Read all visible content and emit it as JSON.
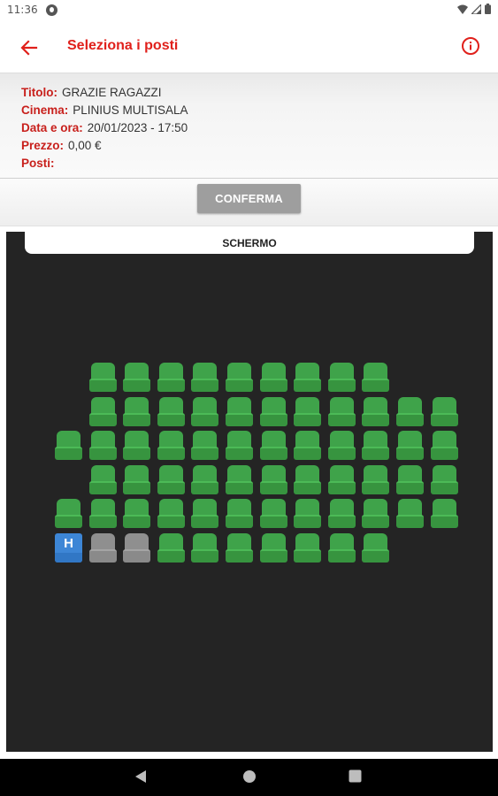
{
  "status_bar": {
    "time": "11:36"
  },
  "app_bar": {
    "title": "Seleziona i posti",
    "back_icon": "arrow-left-icon",
    "info_icon": "info-circle-icon",
    "accent_color": "#e0201b"
  },
  "info": {
    "title_label": "Titolo:",
    "title_value": "GRAZIE RAGAZZI",
    "cinema_label": "Cinema:",
    "cinema_value": "PLINIUS MULTISALA",
    "date_label": "Data e ora:",
    "date_value": "20/01/2023 - 17:50",
    "price_label": "Prezzo:",
    "price_value": "0,00 €",
    "seats_label": "Posti:",
    "seats_value": ""
  },
  "confirm_button": {
    "label": "CONFERMA"
  },
  "hall": {
    "screen_label": "SCHERMO",
    "colors": {
      "free": "#3fa34a",
      "taken": "#8f8f8f",
      "handicap": "#3d86d6",
      "background": "#242424"
    },
    "legend_handicap_letter": "H",
    "rows": [
      [
        "empty",
        "free",
        "free",
        "free",
        "free",
        "free",
        "free",
        "free",
        "free",
        "free",
        "empty",
        "empty"
      ],
      [
        "empty",
        "free",
        "free",
        "free",
        "free",
        "free",
        "free",
        "free",
        "free",
        "free",
        "free",
        "free"
      ],
      [
        "free",
        "free",
        "free",
        "free",
        "free",
        "free",
        "free",
        "free",
        "free",
        "free",
        "free",
        "free"
      ],
      [
        "empty",
        "free",
        "free",
        "free",
        "free",
        "free",
        "free",
        "free",
        "free",
        "free",
        "free",
        "free"
      ],
      [
        "free",
        "free",
        "free",
        "free",
        "free",
        "free",
        "free",
        "free",
        "free",
        "free",
        "free",
        "free"
      ],
      [
        "handicap",
        "taken",
        "taken",
        "free",
        "free",
        "free",
        "free",
        "free",
        "free",
        "free",
        "empty",
        "empty"
      ]
    ]
  },
  "nav_bar": {
    "back_icon": "triangle-back-icon",
    "home_icon": "circle-home-icon",
    "recents_icon": "square-recents-icon"
  }
}
